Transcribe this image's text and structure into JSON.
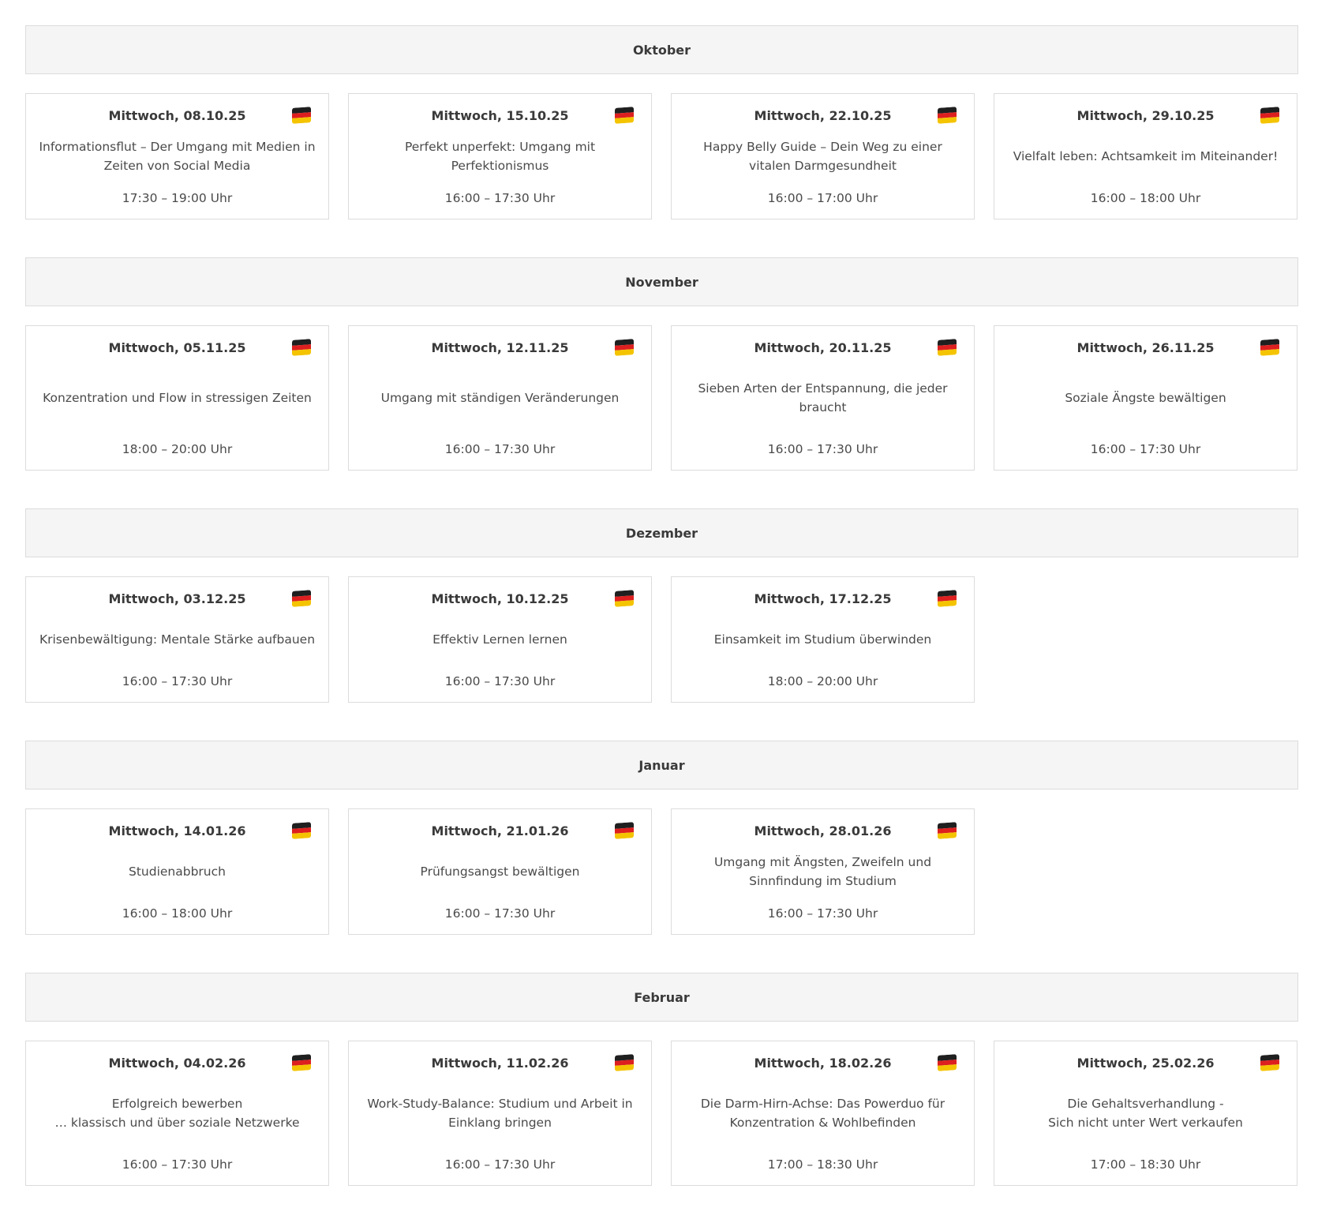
{
  "months": [
    {
      "name": "Oktober",
      "events": [
        {
          "date": "Mittwoch, 08.10.25",
          "title": "Informationsflut – Der Umgang mit Medien in Zeiten von Social Media",
          "time": "17:30 – 19:00 Uhr",
          "language": "german-flag-icon"
        },
        {
          "date": "Mittwoch, 15.10.25",
          "title": "Perfekt unperfekt: Umgang mit Perfektionismus",
          "time": "16:00 – 17:30 Uhr",
          "language": "german-flag-icon"
        },
        {
          "date": "Mittwoch, 22.10.25",
          "title": "Happy Belly Guide – Dein Weg zu einer vitalen Darmgesundheit",
          "time": "16:00 – 17:00 Uhr",
          "language": "german-flag-icon"
        },
        {
          "date": "Mittwoch, 29.10.25",
          "title": "Vielfalt leben: Achtsamkeit im Miteinander!",
          "time": "16:00 – 18:00 Uhr",
          "language": "german-flag-icon"
        }
      ]
    },
    {
      "name": "November",
      "events": [
        {
          "date": "Mittwoch, 05.11.25",
          "title": "Konzentration und Flow in stressigen Zeiten",
          "time": "18:00 – 20:00 Uhr",
          "language": "german-flag-icon"
        },
        {
          "date": "Mittwoch, 12.11.25",
          "title": "Umgang mit ständigen Veränderungen",
          "time": "16:00 – 17:30 Uhr",
          "language": "german-flag-icon"
        },
        {
          "date": "Mittwoch, 20.11.25",
          "title": "Sieben Arten der Entspannung, die jeder braucht",
          "time": "16:00 – 17:30 Uhr",
          "language": "german-flag-icon"
        },
        {
          "date": "Mittwoch, 26.11.25",
          "title": "Soziale Ängste bewältigen",
          "time": "16:00 – 17:30 Uhr",
          "language": "german-flag-icon"
        }
      ]
    },
    {
      "name": "Dezember",
      "events": [
        {
          "date": "Mittwoch, 03.12.25",
          "title": "Krisenbewältigung: Mentale Stärke aufbauen",
          "time": "16:00 – 17:30 Uhr",
          "language": "german-flag-icon"
        },
        {
          "date": "Mittwoch, 10.12.25",
          "title": "Effektiv Lernen lernen",
          "time": "16:00 – 17:30 Uhr",
          "language": "german-flag-icon"
        },
        {
          "date": "Mittwoch, 17.12.25",
          "title": "Einsamkeit im Studium überwinden",
          "time": "18:00 – 20:00 Uhr",
          "language": "german-flag-icon"
        }
      ]
    },
    {
      "name": "Januar",
      "events": [
        {
          "date": "Mittwoch, 14.01.26",
          "title": "Studienabbruch",
          "time": "16:00 – 18:00 Uhr",
          "language": "german-flag-icon"
        },
        {
          "date": "Mittwoch, 21.01.26",
          "title": "Prüfungsangst bewältigen",
          "time": "16:00 – 17:30 Uhr",
          "language": "german-flag-icon"
        },
        {
          "date": "Mittwoch, 28.01.26",
          "title": "Umgang mit Ängsten, Zweifeln und Sinnfindung im Studium",
          "time": "16:00 – 17:30 Uhr",
          "language": "german-flag-icon"
        }
      ]
    },
    {
      "name": "Februar",
      "events": [
        {
          "date": "Mittwoch, 04.02.26",
          "title": "Erfolgreich bewerben\n… klassisch und über soziale Netzwerke",
          "time": "16:00 – 17:30 Uhr",
          "language": "german-flag-icon"
        },
        {
          "date": "Mittwoch, 11.02.26",
          "title": "Work-Study-Balance: Studium und Arbeit in Einklang bringen",
          "time": "16:00 – 17:30 Uhr",
          "language": "german-flag-icon"
        },
        {
          "date": "Mittwoch, 18.02.26",
          "title": "Die Darm-Hirn-Achse: Das Powerduo für Konzentration & Wohlbefinden",
          "time": "17:00 – 18:30 Uhr",
          "language": "german-flag-icon"
        },
        {
          "date": "Mittwoch, 25.02.26",
          "title": "Die Gehaltsverhandlung -\nSich nicht unter Wert verkaufen",
          "time": "17:00 – 18:30 Uhr",
          "language": "german-flag-icon"
        }
      ]
    }
  ],
  "colors": {
    "header_bg": "#f5f5f5",
    "border": "#dcdcdc",
    "text": "#4a4a4a"
  }
}
